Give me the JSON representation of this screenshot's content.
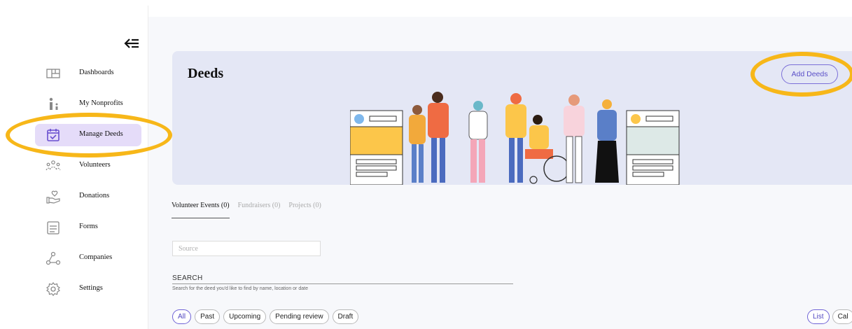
{
  "sidebar": {
    "items": [
      {
        "label": "Dashboards",
        "icon": "dashboard-icon"
      },
      {
        "label": "My Nonprofits",
        "icon": "nonprofits-icon"
      },
      {
        "label": "Manage Deeds",
        "icon": "calendar-check-icon",
        "active": true
      },
      {
        "label": "Volunteers",
        "icon": "volunteers-icon"
      },
      {
        "label": "Donations",
        "icon": "donation-hand-icon"
      },
      {
        "label": "Forms",
        "icon": "form-icon"
      },
      {
        "label": "Companies",
        "icon": "companies-icon"
      },
      {
        "label": "Settings",
        "icon": "gear-icon"
      }
    ]
  },
  "header": {
    "title": "Deeds",
    "add_button": "Add Deeds"
  },
  "tabs": [
    {
      "label": "Volunteer Events (0)",
      "active": true
    },
    {
      "label": "Fundraisers (0)",
      "active": false
    },
    {
      "label": "Projects (0)",
      "active": false
    }
  ],
  "source": {
    "placeholder": "Source"
  },
  "search": {
    "label": "SEARCH",
    "help": "Search for the deed you'd like to find by name, location or date"
  },
  "filters": [
    "All",
    "Past",
    "Upcoming",
    "Pending review",
    "Draft"
  ],
  "views": [
    "List",
    "Cal"
  ],
  "colors": {
    "accent": "#6f63d6",
    "highlight": "#f7b719",
    "hero_bg": "#e4e7f5",
    "active_nav": "#e5dcf9"
  }
}
